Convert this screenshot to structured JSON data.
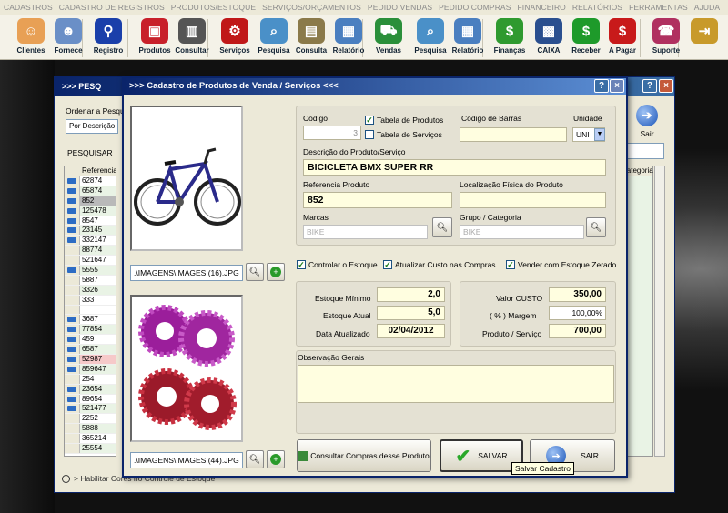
{
  "menu": [
    "CADASTROS",
    "CADASTRO DE REGISTROS",
    "PRODUTOS/ESTOQUE",
    "SERVIÇOS/ORÇAMENTOS",
    "PEDIDO VENDAS",
    "PEDIDO COMPRAS",
    "FINANCEIRO",
    "RELATÓRIOS",
    "FERRAMENTAS",
    "AJUDA"
  ],
  "toolbar": [
    {
      "label": "Clientes",
      "icon": "users-icon",
      "color": "#e8a055",
      "glyph": "☺"
    },
    {
      "label": "Fornece",
      "icon": "supplier-icon",
      "color": "#6a8fc7",
      "glyph": "☻"
    },
    {
      "label": "Registro",
      "icon": "bicycle-icon",
      "color": "#1a3faa",
      "glyph": "⚲"
    },
    {
      "label": "Produtos",
      "icon": "toolbox-icon",
      "color": "#c8202a",
      "glyph": "▣"
    },
    {
      "label": "Consultar",
      "icon": "barcode-icon",
      "color": "#555555",
      "glyph": "▥"
    },
    {
      "label": "Serviços",
      "icon": "chain-icon",
      "color": "#c01818",
      "glyph": "⚙"
    },
    {
      "label": "Pesquisa",
      "icon": "magnifier-icon",
      "color": "#4a90c8",
      "glyph": "⌕"
    },
    {
      "label": "Consulta",
      "icon": "document-icon",
      "color": "#8b7a4a",
      "glyph": "▤"
    },
    {
      "label": "Relatório",
      "icon": "report-icon",
      "color": "#4a7fc0",
      "glyph": "▦"
    },
    {
      "label": "Vendas",
      "icon": "cart-icon",
      "color": "#2a8f3a",
      "glyph": "⛟"
    },
    {
      "label": "Pesquisa",
      "icon": "magnifier-icon",
      "color": "#4a90c8",
      "glyph": "⌕"
    },
    {
      "label": "Relatório",
      "icon": "report-icon",
      "color": "#4a7fc0",
      "glyph": "▦"
    },
    {
      "label": "Finanças",
      "icon": "money-icon",
      "color": "#2f9a2f",
      "glyph": "$"
    },
    {
      "label": "CAIXA",
      "icon": "cashbox-icon",
      "color": "#2a4f8f",
      "glyph": "▩"
    },
    {
      "label": "Receber",
      "icon": "dollar-green-icon",
      "color": "#1e9a2a",
      "glyph": "$"
    },
    {
      "label": "A Pagar",
      "icon": "dollar-red-icon",
      "color": "#c81a1a",
      "glyph": "$"
    },
    {
      "label": "Suporte",
      "icon": "support-icon",
      "color": "#b03060",
      "glyph": "☎"
    },
    {
      "label": "",
      "icon": "exit-icon",
      "color": "#c89a2a",
      "glyph": "⇥"
    }
  ],
  "bg_window": {
    "title": ">>> PESQ",
    "order_label": "Ordenar a Pesquisa",
    "order_value": "Por Descrição",
    "search_label": "PESQUISAR",
    "col_ref": "Referencia",
    "col_cat": "Categoria",
    "sair": "Sair",
    "rows": [
      "62874",
      "65874",
      "852",
      "125478",
      "8547",
      "23145",
      "332147",
      "88774",
      "521647",
      "5555",
      "5887",
      "3326",
      "333",
      "",
      "3687",
      "77854",
      "459",
      "6587",
      "52987",
      "859647",
      "254",
      "23654",
      "89654",
      "521477",
      "2252",
      "5888",
      "365214",
      "25554"
    ],
    "legend": "> Habilitar Cores no Controle de Estoque"
  },
  "dialog": {
    "title": ">>>  Cadastro de Produtos de Venda / Serviços  <<<",
    "img1_path": ".\\IMAGENS\\IMAGES (16).JPG",
    "img2_path": ".\\IMAGENS\\IMAGES (44).JPG",
    "codigo_label": "Código",
    "codigo_value": "3",
    "chk_produtos": "Tabela de Produtos",
    "chk_servicos": "Tabela de Serviços",
    "barras_label": "Código de Barras",
    "barras_value": "",
    "unidade_label": "Unidade",
    "unidade_value": "UNI",
    "descricao_label": "Descrição do Produto/Serviço",
    "descricao_value": "BICICLETA  BMX SUPER RR",
    "referencia_label": "Referencia Produto",
    "referencia_value": "852",
    "localizacao_label": "Localização Física do Produto",
    "localizacao_value": "",
    "marcas_label": "Marcas",
    "marcas_value": "BIKE",
    "grupo_label": "Grupo / Categoria",
    "grupo_value": "BIKE",
    "chk_controlar": "Controlar o Estoque",
    "chk_atualizar": "Atualizar Custo nas Compras",
    "chk_vender": "Vender com Estoque Zerado",
    "est_min_label": "Estoque Mínimo",
    "est_min_value": "2,0",
    "est_atual_label": "Estoque Atual",
    "est_atual_value": "5,0",
    "data_label": "Data Atualizado",
    "data_value": "02/04/2012",
    "custo_label": "Valor CUSTO",
    "custo_value": "350,00",
    "margem_label": "( % ) Margem",
    "margem_value": "100,00%",
    "preco_label": "Produto / Serviço",
    "preco_value": "700,00",
    "obs_label": "Observação Gerais",
    "btn_consultar": "Consultar Compras desse Produto",
    "btn_salvar": "SALVAR",
    "btn_sair": "SAIR",
    "tooltip": "Salvar Cadastro"
  }
}
